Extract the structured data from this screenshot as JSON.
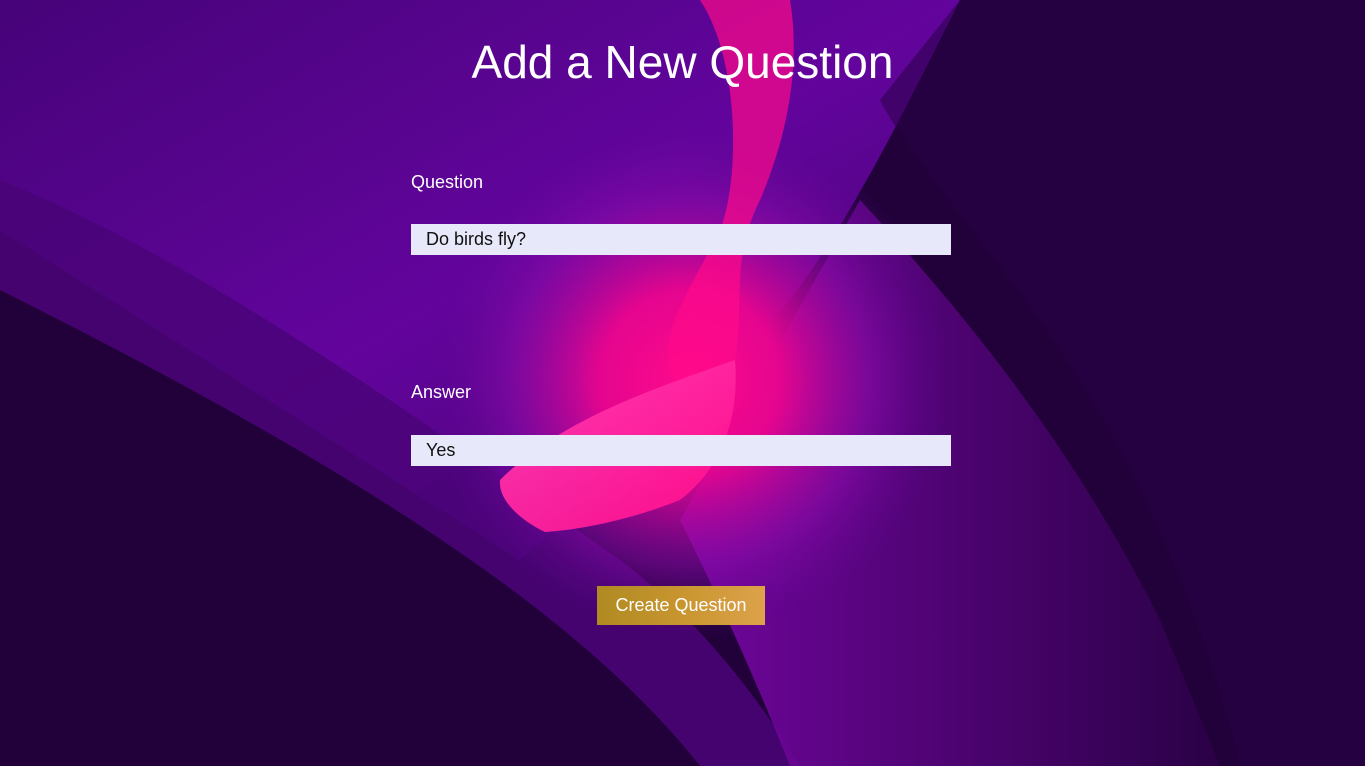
{
  "page": {
    "title": "Add a New Question"
  },
  "form": {
    "question_label": "Question",
    "question_value": "Do birds fly?",
    "answer_label": "Answer",
    "answer_value": "Yes",
    "submit_label": "Create Question"
  },
  "colors": {
    "background_dark": "#22013a",
    "background_purple": "#5f0494",
    "background_pink": "#ff0a8a",
    "input_background": "#e8e8fb",
    "button_gradient_start": "#b08a22",
    "button_gradient_end": "#dda24a",
    "text_light": "#ffffff"
  }
}
